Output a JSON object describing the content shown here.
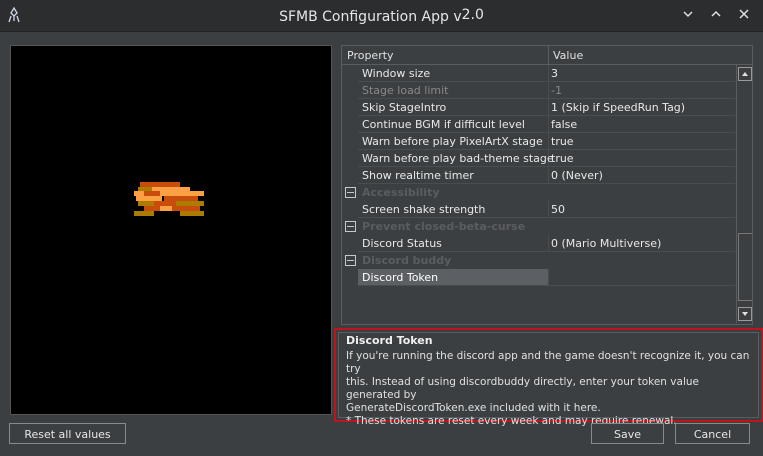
{
  "window": {
    "title": "SFMB Configuration App v",
    "version": "2.0",
    "icons": [
      "app-icon",
      "minimize-icon",
      "maximize-icon",
      "close-icon"
    ]
  },
  "grid": {
    "columns": [
      "Property",
      "Value"
    ],
    "rows": [
      {
        "type": "prop",
        "name": "Window size",
        "value": "3"
      },
      {
        "type": "prop",
        "name": "Stage load limit",
        "value": "-1",
        "disabled": true
      },
      {
        "type": "prop",
        "name": "Skip StageIntro",
        "value": "1 (Skip if SpeedRun Tag)"
      },
      {
        "type": "prop",
        "name": "Continue BGM if difficult level",
        "value": "false"
      },
      {
        "type": "prop",
        "name": "Warn before play PixelArtX stage",
        "value": "true"
      },
      {
        "type": "prop",
        "name": "Warn before play bad-theme stage",
        "value": "true"
      },
      {
        "type": "prop",
        "name": "Show realtime timer",
        "value": "0 (Never)"
      },
      {
        "type": "category",
        "name": "Accessibility"
      },
      {
        "type": "prop",
        "name": "Screen shake strength",
        "value": "50"
      },
      {
        "type": "category",
        "name": "Prevent closed-beta-curse"
      },
      {
        "type": "prop",
        "name": "Discord Status",
        "value": "0 (Mario Multiverse)"
      },
      {
        "type": "category",
        "name": "Discord buddy"
      },
      {
        "type": "prop",
        "name": "Discord Token",
        "value": "",
        "selected": true
      }
    ]
  },
  "description": {
    "title": "Discord Token",
    "lines": [
      "If you're running the discord app and the game doesn't recognize it, you can try",
      "this. Instead of using discordbuddy directly, enter your token value generated by",
      "GenerateDiscordToken.exe included with it here.",
      "* These tokens are reset every week and may require renewal."
    ]
  },
  "buttons": {
    "reset": "Reset all values",
    "save": "Save",
    "cancel": "Cancel"
  }
}
